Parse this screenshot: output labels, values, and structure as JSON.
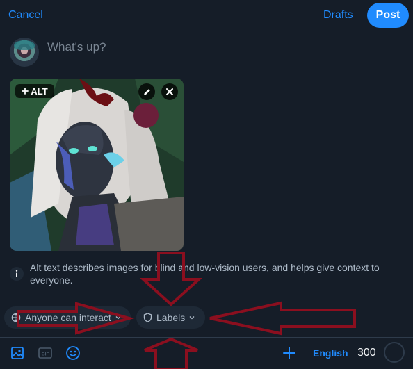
{
  "header": {
    "cancel_label": "Cancel",
    "drafts_label": "Drafts",
    "post_label": "Post"
  },
  "composer": {
    "placeholder": "What's up?"
  },
  "attachment": {
    "alt_label": "ALT",
    "alt_icon": "plus-icon",
    "edit_icon": "pencil-icon",
    "remove_icon": "close-icon"
  },
  "info": {
    "icon": "info-icon",
    "text": "Alt text describes images for blind and low-vision users, and helps give context to everyone."
  },
  "chips": {
    "interaction": {
      "label": "Anyone can interact",
      "icon": "globe-icon"
    },
    "labels": {
      "label": "Labels",
      "icon": "shield-icon"
    }
  },
  "toolbar": {
    "icons": [
      "image-icon",
      "gif-icon",
      "emoji-icon",
      "plus-icon"
    ],
    "language_label": "English",
    "char_count": "300"
  },
  "colors": {
    "accent": "#208bfe",
    "background": "#151d28",
    "chip": "#1e2936",
    "annotation": "#8b0f1f"
  }
}
